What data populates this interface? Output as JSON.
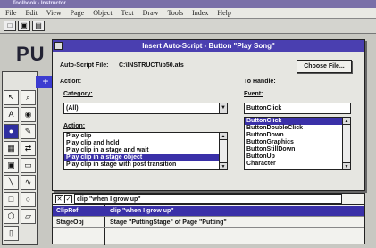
{
  "app": {
    "title": "Toolbook - Instructor"
  },
  "menu": [
    "File",
    "Edit",
    "View",
    "Page",
    "Object",
    "Text",
    "Draw",
    "Tools",
    "Index",
    "Help"
  ],
  "background": {
    "page_title": "PU"
  },
  "dialog": {
    "title": "Insert Auto-Script - Button \"Play Song\"",
    "script_file_label": "Auto-Script File:",
    "script_file_value": "C:\\INSTRUCT\\ib50.ats",
    "choose_file_label": "Choose File...",
    "action_label": "Action:",
    "category_label": "Category:",
    "category_value": "(All)",
    "action_list_label": "Action:",
    "actions": [
      "Play clip",
      "Play clip and hold",
      "Play clip in a stage and wait",
      "Play clip in a stage object",
      "Play clip in stage with post transition"
    ],
    "selected_action_index": 3,
    "to_handle_label": "To Handle:",
    "event_label": "Event:",
    "event_value": "ButtonClick",
    "events": [
      "ButtonClick",
      "ButtonDoubleClick",
      "ButtonDown",
      "ButtonGraphics",
      "ButtonStillDown",
      "ButtonUp",
      "Character"
    ],
    "selected_event_index": 0
  },
  "editor": {
    "script_text": "clip \"when I grow up\"",
    "rows": [
      {
        "name": "ClipRef",
        "value": "clip \"when I grow up\""
      },
      {
        "name": "StageObj",
        "value": "Stage \"PuttingStage\" of Page \"Putting\""
      }
    ],
    "selected_row": 0
  },
  "colors": {
    "title_bar": "#4a3fb0",
    "selection": "#3a30a8",
    "dialog_bg": "#e6e6e1"
  }
}
